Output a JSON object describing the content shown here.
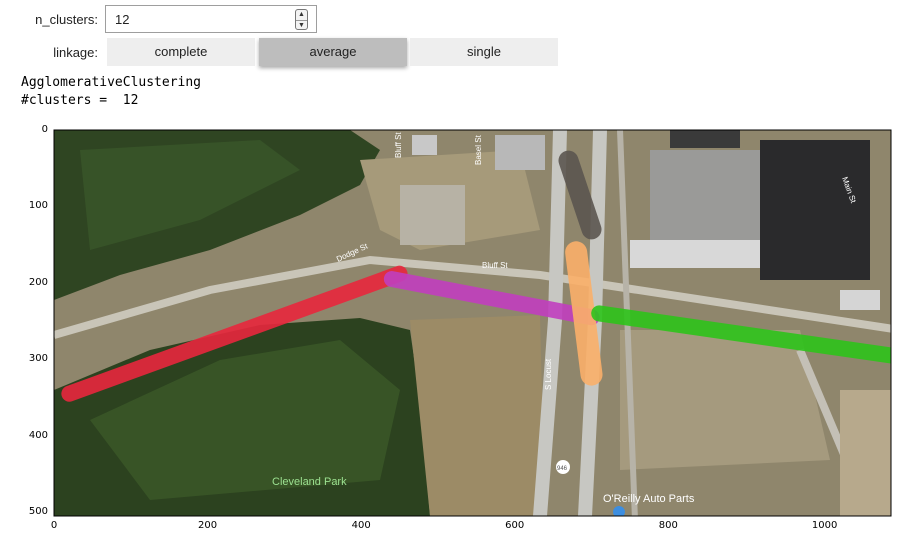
{
  "controls": {
    "n_clusters_label": "n_clusters:",
    "n_clusters_value": "12",
    "spin_up": "▲",
    "spin_down": "▼",
    "linkage_label": "linkage:",
    "linkage_options": [
      "complete",
      "average",
      "single"
    ],
    "linkage_selected": "average"
  },
  "output": {
    "line1": "AgglomerativeClustering",
    "line2": "#clusters =  12"
  },
  "map_labels": {
    "park": "Cleveland Park",
    "business": "O'Reilly Auto Parts",
    "street_dodge": "Dodge St",
    "street_bluff_top": "Bluff St",
    "street_bluff": "Bluff St",
    "street_locust": "S Locust",
    "street_basel": "Basel St",
    "street_main": "Main St",
    "route": "946"
  },
  "chart_data": {
    "type": "scatter",
    "xlim": [
      0,
      1090
    ],
    "ylim": [
      505,
      0
    ],
    "x_ticks": [
      0,
      200,
      400,
      600,
      800,
      1000
    ],
    "y_ticks": [
      0,
      100,
      200,
      300,
      400,
      500
    ],
    "cluster_colors": [
      "#e8273d",
      "#c13fbf",
      "#fbb06a",
      "#2ec41b",
      "#5c5650",
      "#27d6c9",
      "#3f8fe0"
    ],
    "series": [
      {
        "color": "#e8273d",
        "start": [
          20,
          345
        ],
        "end": [
          450,
          188
        ]
      },
      {
        "color": "#c13fbf",
        "start": [
          440,
          195
        ],
        "end": [
          700,
          245
        ]
      },
      {
        "color": "#fbb06a",
        "start": [
          680,
          160
        ],
        "end": [
          700,
          320
        ]
      },
      {
        "color": "#2ec41b",
        "start": [
          710,
          240
        ],
        "end": [
          1090,
          295
        ]
      },
      {
        "color": "#5c5650",
        "start": [
          670,
          40
        ],
        "end": [
          700,
          130
        ]
      }
    ]
  }
}
